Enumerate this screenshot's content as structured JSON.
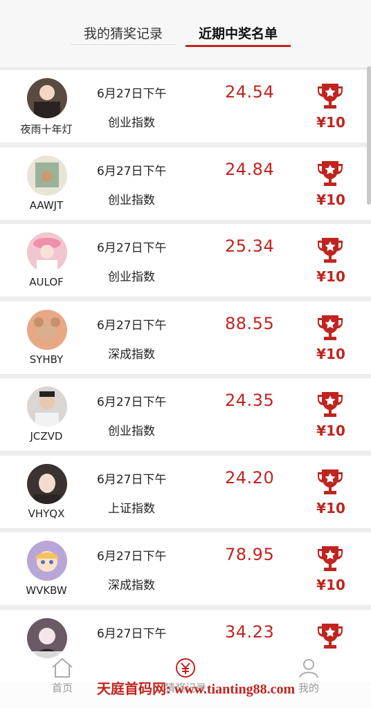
{
  "tabs": {
    "my_records": "我的猜奖记录",
    "winners": "近期中奖名单"
  },
  "colors": {
    "accent": "#c0241e"
  },
  "rows": [
    {
      "name": "夜雨十年灯",
      "date": "6月27日下午",
      "index": "创业指数",
      "score": "24.54",
      "prize": "¥10",
      "avatar_bg": "#5a4b40"
    },
    {
      "name": "AAWJT",
      "date": "6月27日下午",
      "index": "创业指数",
      "score": "24.84",
      "prize": "¥10",
      "avatar_bg": "#e8e4d6"
    },
    {
      "name": "AULOF",
      "date": "6月27日下午",
      "index": "创业指数",
      "score": "25.34",
      "prize": "¥10",
      "avatar_bg": "#f1c6cf"
    },
    {
      "name": "SYHBY",
      "date": "6月27日下午",
      "index": "深成指数",
      "score": "88.55",
      "prize": "¥10",
      "avatar_bg": "#e8a886"
    },
    {
      "name": "JCZVD",
      "date": "6月27日下午",
      "index": "创业指数",
      "score": "24.35",
      "prize": "¥10",
      "avatar_bg": "#d9d6d4"
    },
    {
      "name": "VHYQX",
      "date": "6月27日下午",
      "index": "上证指数",
      "score": "24.20",
      "prize": "¥10",
      "avatar_bg": "#3b332f"
    },
    {
      "name": "WVKBW",
      "date": "6月27日下午",
      "index": "深成指数",
      "score": "78.95",
      "prize": "¥10",
      "avatar_bg": "#b8a6d8"
    },
    {
      "name": "",
      "date": "6月27日下午",
      "index": "",
      "score": "34.23",
      "prize": "",
      "avatar_bg": "#6b5a66"
    }
  ],
  "nav": {
    "home": "首页",
    "record": "猜奖记录",
    "mine": "我的"
  },
  "watermark": "天庭首码网: www.tianting88.com",
  "icons": {
    "trophy": "trophy-icon",
    "home": "home-icon",
    "record": "yuan-icon",
    "mine": "person-icon"
  }
}
